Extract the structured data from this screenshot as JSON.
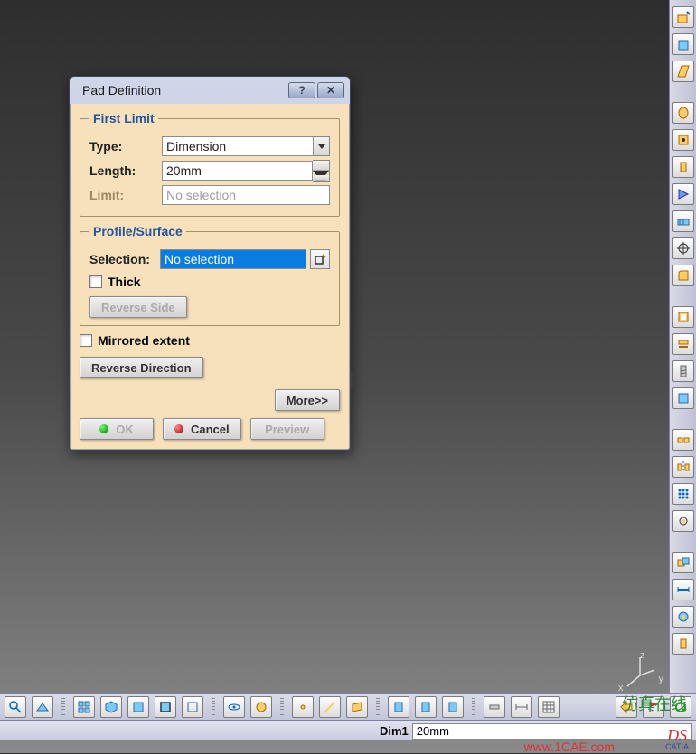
{
  "dialog": {
    "title": "Pad Definition",
    "group1": {
      "legend": "First Limit",
      "typeLabel": "Type:",
      "typeValue": "Dimension",
      "lengthLabel": "Length:",
      "lengthValue": "20mm",
      "limitLabel": "Limit:",
      "limitValue": "No selection"
    },
    "group2": {
      "legend": "Profile/Surface",
      "selectionLabel": "Selection:",
      "selectionValue": "No selection",
      "thickLabel": "Thick",
      "reverseSide": "Reverse Side"
    },
    "mirroredLabel": "Mirrored extent",
    "reverseDirection": "Reverse Direction",
    "moreLabel": "More>>",
    "okLabel": "OK",
    "cancelLabel": "Cancel",
    "previewLabel": "Preview"
  },
  "watermark": "1CAE.COM",
  "status": {
    "dimLabel": "Dim1",
    "dimValue": "20mm"
  },
  "credit": "www.1CAE.com",
  "siteName": "仿真在线",
  "catiaLabel": "CATIA"
}
